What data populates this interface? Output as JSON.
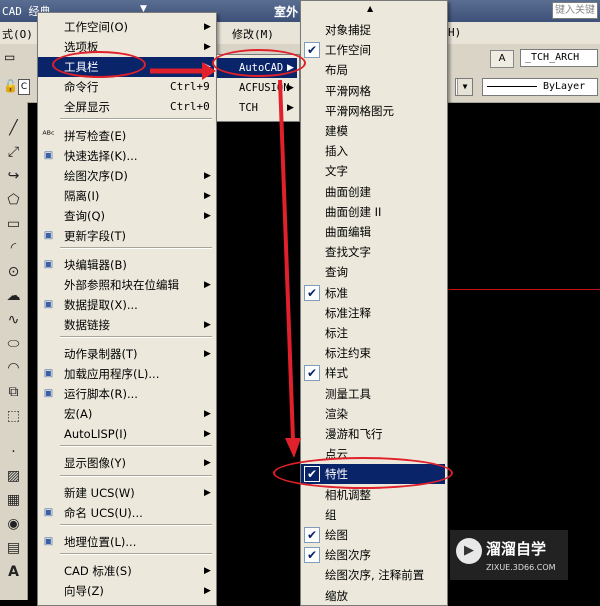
{
  "titlebar": {
    "app_title": "CAD 经典",
    "window_title": "室外",
    "search_placeholder": "键入关键"
  },
  "menubar": {
    "items": [
      "式(O)",
      "修改(M)",
      "H)"
    ]
  },
  "toolbar": {
    "style_combo": "_TCH_ARCH",
    "linetype_combo": "ByLayer",
    "layer_prefix": "C"
  },
  "tools_menu": {
    "items": [
      {
        "label": "工作空间(O)",
        "arrow": true
      },
      {
        "label": "选项板",
        "arrow": true
      },
      {
        "label": "工具栏",
        "arrow": true
      },
      {
        "label": "命令行",
        "shortcut": "Ctrl+9"
      },
      {
        "label": "全屏显示",
        "shortcut": "Ctrl+0"
      },
      {
        "label": "拼写检查(E)",
        "icon": "ABC"
      },
      {
        "label": "快速选择(K)...",
        "icon": "qs"
      },
      {
        "label": "绘图次序(D)",
        "arrow": true
      },
      {
        "label": "隔离(I)",
        "arrow": true
      },
      {
        "label": "查询(Q)",
        "arrow": true
      },
      {
        "label": "更新字段(T)",
        "icon": "uf"
      },
      {
        "label": "块编辑器(B)",
        "icon": "be"
      },
      {
        "label": "外部参照和块在位编辑",
        "arrow": true
      },
      {
        "label": "数据提取(X)...",
        "icon": "dx"
      },
      {
        "label": "数据链接",
        "arrow": true
      },
      {
        "label": "动作录制器(T)",
        "arrow": true
      },
      {
        "label": "加载应用程序(L)...",
        "icon": "la"
      },
      {
        "label": "运行脚本(R)...",
        "icon": "rs"
      },
      {
        "label": "宏(A)",
        "arrow": true
      },
      {
        "label": "AutoLISP(I)",
        "arrow": true
      },
      {
        "label": "显示图像(Y)",
        "arrow": true
      },
      {
        "label": "新建 UCS(W)",
        "arrow": true
      },
      {
        "label": "命名 UCS(U)...",
        "icon": "uc"
      },
      {
        "label": "地理位置(L)...",
        "icon": "gl"
      },
      {
        "label": "CAD 标准(S)",
        "arrow": true
      },
      {
        "label": "向导(Z)",
        "arrow": true
      }
    ]
  },
  "toolbar_submenu": {
    "items": [
      {
        "label": "AutoCAD",
        "arrow": true
      },
      {
        "label": "ACFUSION",
        "arrow": true
      },
      {
        "label": "TCH",
        "arrow": true
      }
    ]
  },
  "autocad_submenu": {
    "items": [
      {
        "label": "对象捕捉",
        "checked": false
      },
      {
        "label": "工作空间",
        "checked": true
      },
      {
        "label": "布局",
        "checked": false
      },
      {
        "label": "平滑网格",
        "checked": false
      },
      {
        "label": "平滑网格图元",
        "checked": false
      },
      {
        "label": "建模",
        "checked": false
      },
      {
        "label": "插入",
        "checked": false
      },
      {
        "label": "文字",
        "checked": false
      },
      {
        "label": "曲面创建",
        "checked": false
      },
      {
        "label": "曲面创建 II",
        "checked": false
      },
      {
        "label": "曲面编辑",
        "checked": false
      },
      {
        "label": "查找文字",
        "checked": false
      },
      {
        "label": "查询",
        "checked": false
      },
      {
        "label": "标准",
        "checked": true
      },
      {
        "label": "标准注释",
        "checked": false
      },
      {
        "label": "标注",
        "checked": false
      },
      {
        "label": "标注约束",
        "checked": false
      },
      {
        "label": "样式",
        "checked": true
      },
      {
        "label": "测量工具",
        "checked": false
      },
      {
        "label": "渲染",
        "checked": false
      },
      {
        "label": "漫游和飞行",
        "checked": false
      },
      {
        "label": "点云",
        "checked": false
      },
      {
        "label": "特性",
        "checked": true
      },
      {
        "label": "相机调整",
        "checked": false
      },
      {
        "label": "组",
        "checked": false
      },
      {
        "label": "绘图",
        "checked": true
      },
      {
        "label": "绘图次序",
        "checked": true
      },
      {
        "label": "绘图次序, 注释前置",
        "checked": false
      },
      {
        "label": "缩放",
        "checked": false
      }
    ]
  },
  "watermark": {
    "text": "溜溜自学",
    "url": "ZIXUE.3D66.COM"
  },
  "colors": {
    "highlight": "#0a246a",
    "annotation": "#e0202a",
    "menu_bg": "#ece9dc"
  }
}
